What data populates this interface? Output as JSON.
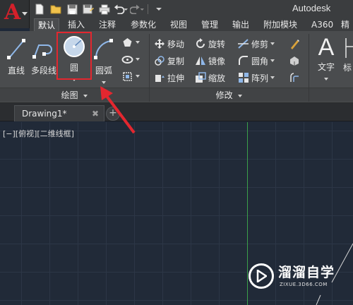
{
  "app": {
    "title": "Autodesk",
    "logo_letter": "A"
  },
  "quick_access": [
    "new-icon",
    "open-icon",
    "save-icon",
    "save-as-icon",
    "print-icon",
    "undo-icon",
    "redo-icon"
  ],
  "tabs": [
    {
      "label": "默认",
      "active": true
    },
    {
      "label": "插入"
    },
    {
      "label": "注释"
    },
    {
      "label": "参数化"
    },
    {
      "label": "视图"
    },
    {
      "label": "管理"
    },
    {
      "label": "输出"
    },
    {
      "label": "附加模块"
    },
    {
      "label": "A360"
    },
    {
      "label": "精"
    }
  ],
  "draw_panel": {
    "title": "绘图",
    "line": "直线",
    "polyline": "多段线",
    "circle": "圆",
    "arc": "圆弧"
  },
  "modify_panel": {
    "title": "修改",
    "move": "移动",
    "rotate": "旋转",
    "trim": "修剪",
    "copy": "复制",
    "mirror": "镜像",
    "fillet": "圆角",
    "stretch": "拉伸",
    "scale": "缩放",
    "array": "阵列"
  },
  "annotation_panel": {
    "text": "文字",
    "partial": "标"
  },
  "document": {
    "tab_name": "Drawing1*",
    "close": "✖",
    "new_tab": "+"
  },
  "viewport": {
    "label": "[−][俯视][二维线框]"
  },
  "watermark": {
    "title": "溜溜自学",
    "subtitle": "ZIXUE.3D66.COM"
  },
  "colors": {
    "accent_red": "#e3272f",
    "ribbon_bg": "#4a4c4e",
    "canvas_bg": "#212a38",
    "ucs_green": "#3aa14a"
  }
}
